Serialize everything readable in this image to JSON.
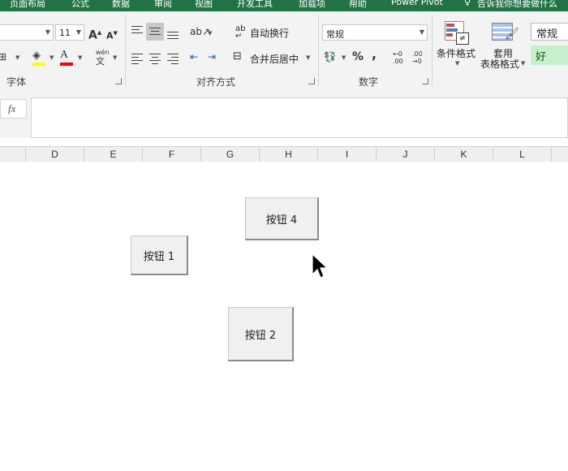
{
  "menu": [
    "页面布局",
    "公式",
    "数据",
    "审阅",
    "视图",
    "开发工具",
    "加载项",
    "帮助",
    "Power Pivot",
    "告诉我你想要做什么"
  ],
  "font": {
    "size": "11",
    "grow_icon": "A",
    "shrink_icon": "A",
    "phonetic_label": "wén",
    "group_label": "字体"
  },
  "alignment": {
    "wrap_label": "自动换行",
    "merge_label": "合并后居中",
    "wrap_icon": "ab",
    "group_label": "对齐方式"
  },
  "number": {
    "format_value": "常规",
    "percent": "%",
    "comma": ",",
    "inc_decimal": ".00",
    "dec_decimal": ".00",
    "group_label": "数字"
  },
  "styles": {
    "conditional_label": "条件格式",
    "table_label_1": "套用",
    "table_label_2": "表格格式",
    "style_normal": "常规",
    "style_good": "好"
  },
  "formula_bar": {
    "fx": "fx",
    "content": ""
  },
  "columns": [
    "D",
    "E",
    "F",
    "G",
    "H",
    "I",
    "J",
    "K",
    "L"
  ],
  "buttons": {
    "btn4": "按钮 4",
    "btn1": "按钮 1",
    "btn2": "按钮 2"
  },
  "colors": {
    "brand": "#217346",
    "fill_yellow": "#ffff00",
    "font_red": "#ff0000",
    "good_bg": "#c6efce",
    "good_text": "#006100"
  }
}
